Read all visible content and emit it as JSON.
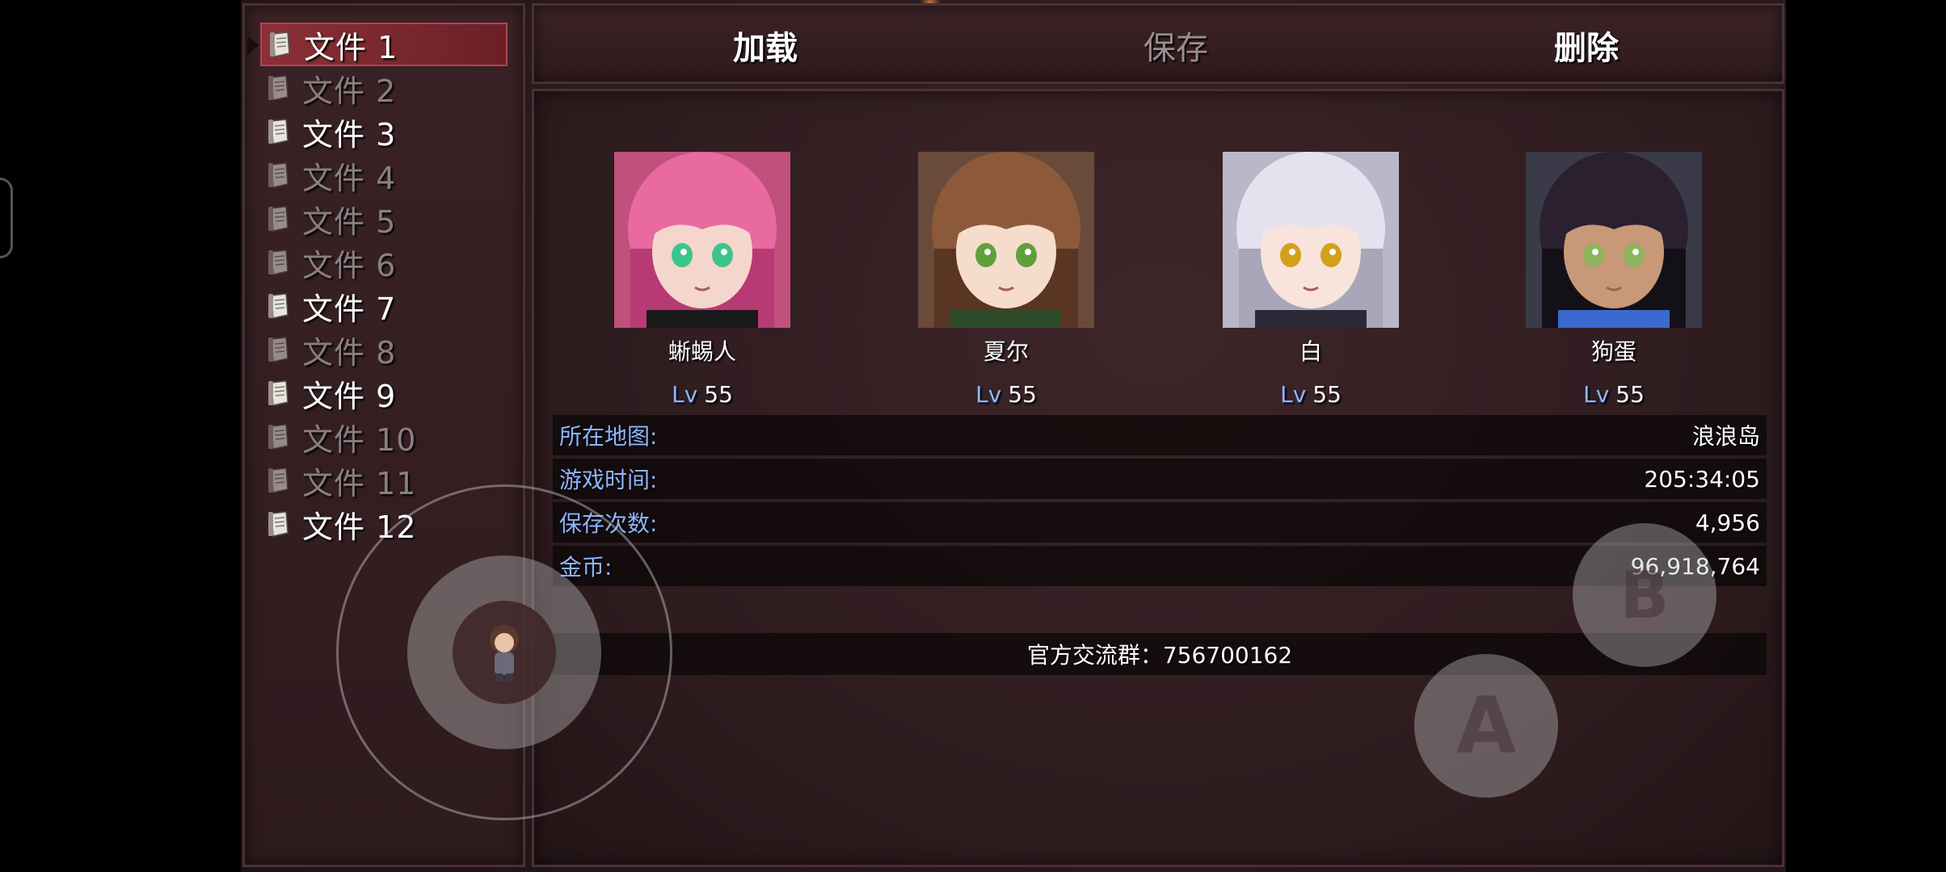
{
  "files": [
    {
      "label": "文件 1",
      "has_save": true,
      "selected": true
    },
    {
      "label": "文件 2",
      "has_save": false,
      "selected": false
    },
    {
      "label": "文件 3",
      "has_save": true,
      "selected": false
    },
    {
      "label": "文件 4",
      "has_save": false,
      "selected": false
    },
    {
      "label": "文件 5",
      "has_save": false,
      "selected": false
    },
    {
      "label": "文件 6",
      "has_save": false,
      "selected": false
    },
    {
      "label": "文件 7",
      "has_save": true,
      "selected": false
    },
    {
      "label": "文件 8",
      "has_save": false,
      "selected": false
    },
    {
      "label": "文件 9",
      "has_save": true,
      "selected": false
    },
    {
      "label": "文件 10",
      "has_save": false,
      "selected": false
    },
    {
      "label": "文件 11",
      "has_save": false,
      "selected": false
    },
    {
      "label": "文件 12",
      "has_save": true,
      "selected": false
    }
  ],
  "actions": {
    "load": "加载",
    "save": "保存",
    "delete": "删除"
  },
  "party": [
    {
      "name": "蜥蜴人",
      "lv_label": "Lv",
      "level": "55",
      "portrait": "pink-hair-portrait"
    },
    {
      "name": "夏尔",
      "lv_label": "Lv",
      "level": "55",
      "portrait": "brown-hair-elf-portrait"
    },
    {
      "name": "白",
      "lv_label": "Lv",
      "level": "55",
      "portrait": "white-hair-portrait"
    },
    {
      "name": "狗蛋",
      "lv_label": "Lv",
      "level": "55",
      "portrait": "dark-hair-portrait"
    }
  ],
  "info": {
    "map_label": "所在地图:",
    "map_value": "浪浪岛",
    "playtime_label": "游戏时间:",
    "playtime_value": "205:34:05",
    "save_count_label": "保存次数:",
    "save_count_value": "4,956",
    "gold_label": "金币:",
    "gold_value": "96,918,764"
  },
  "group": "官方交流群：756700162",
  "controls": {
    "a_label": "A",
    "b_label": "B"
  },
  "colors": {
    "label_blue": "#8fb4ff",
    "selected_red": "#8c2f38",
    "panel_bg": "#2e1b1e"
  }
}
